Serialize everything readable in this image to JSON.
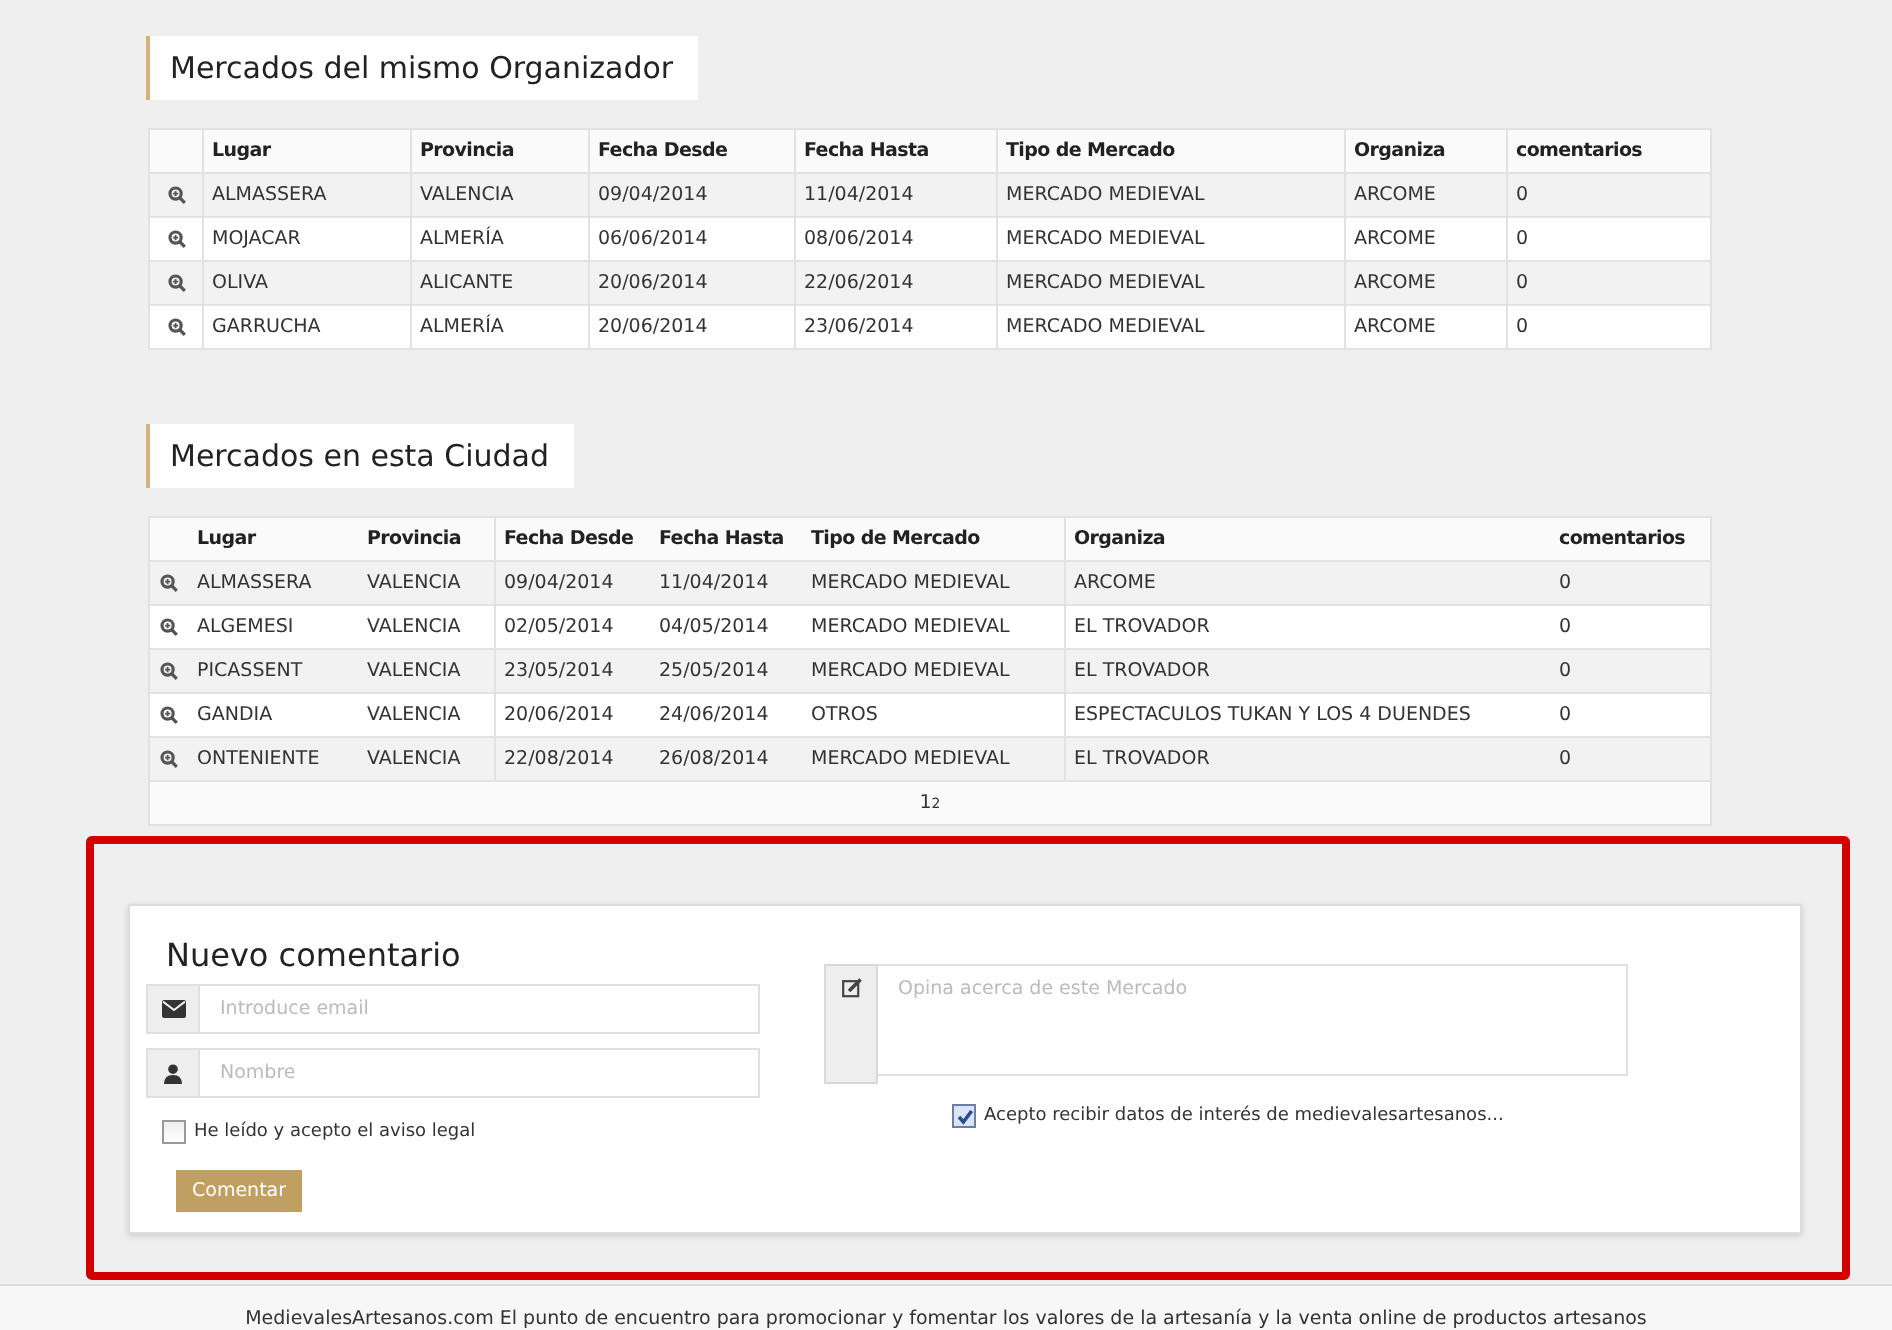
{
  "sections": [
    {
      "title": "Mercados del mismo Organizador",
      "table": {
        "columns": [
          "Lugar",
          "Provincia",
          "Fecha Desde",
          "Fecha Hasta",
          "Tipo de Mercado",
          "Organiza",
          "comentarios"
        ],
        "rows": [
          [
            "ALMASSERA",
            "VALENCIA",
            "09/04/2014",
            "11/04/2014",
            "MERCADO MEDIEVAL",
            "ARCOME",
            "0"
          ],
          [
            "MOJACAR",
            "ALMERÍA",
            "06/06/2014",
            "08/06/2014",
            "MERCADO MEDIEVAL",
            "ARCOME",
            "0"
          ],
          [
            "OLIVA",
            "ALICANTE",
            "20/06/2014",
            "22/06/2014",
            "MERCADO MEDIEVAL",
            "ARCOME",
            "0"
          ],
          [
            "GARRUCHA",
            "ALMERÍA",
            "20/06/2014",
            "23/06/2014",
            "MERCADO MEDIEVAL",
            "ARCOME",
            "0"
          ]
        ]
      }
    },
    {
      "title": "Mercados en esta Ciudad",
      "table": {
        "columns": [
          "Lugar",
          "Provincia",
          "Fecha Desde",
          "Fecha Hasta",
          "Tipo de Mercado",
          "Organiza",
          "comentarios"
        ],
        "rows": [
          [
            "ALMASSERA",
            "VALENCIA",
            "09/04/2014",
            "11/04/2014",
            "MERCADO MEDIEVAL",
            "ARCOME",
            "0"
          ],
          [
            "ALGEMESI",
            "VALENCIA",
            "02/05/2014",
            "04/05/2014",
            "MERCADO MEDIEVAL",
            "EL TROVADOR",
            "0"
          ],
          [
            "PICASSENT",
            "VALENCIA",
            "23/05/2014",
            "25/05/2014",
            "MERCADO MEDIEVAL",
            "EL TROVADOR",
            "0"
          ],
          [
            "GANDIA",
            "VALENCIA",
            "20/06/2014",
            "24/06/2014",
            "OTROS",
            "ESPECTACULOS TUKAN Y LOS 4 DUENDES",
            "0"
          ],
          [
            "ONTENIENTE",
            "VALENCIA",
            "22/08/2014",
            "26/08/2014",
            "MERCADO MEDIEVAL",
            "EL TROVADOR",
            "0"
          ]
        ],
        "pager": [
          {
            "label": "1",
            "selected": true
          },
          {
            "label": "2",
            "selected": false
          }
        ]
      }
    }
  ],
  "comment_form": {
    "title": "Nuevo comentario",
    "email": {
      "placeholder": "Introduce email"
    },
    "name": {
      "placeholder": "Nombre"
    },
    "comment": {
      "placeholder": "Opina acerca de este Mercado"
    },
    "legal_checkbox": {
      "label": "He leído y acepto el aviso legal",
      "checked": false
    },
    "newsletter_checkbox": {
      "label": "Acepto recibir datos de interés de medievalesartesanos...",
      "checked": true
    },
    "button": "Comentar"
  },
  "footer": "MedievalesArtesanos.com El punto de encuentro para promocionar y fomentar los valores de la artesanía y la venta online de productos artesanos"
}
